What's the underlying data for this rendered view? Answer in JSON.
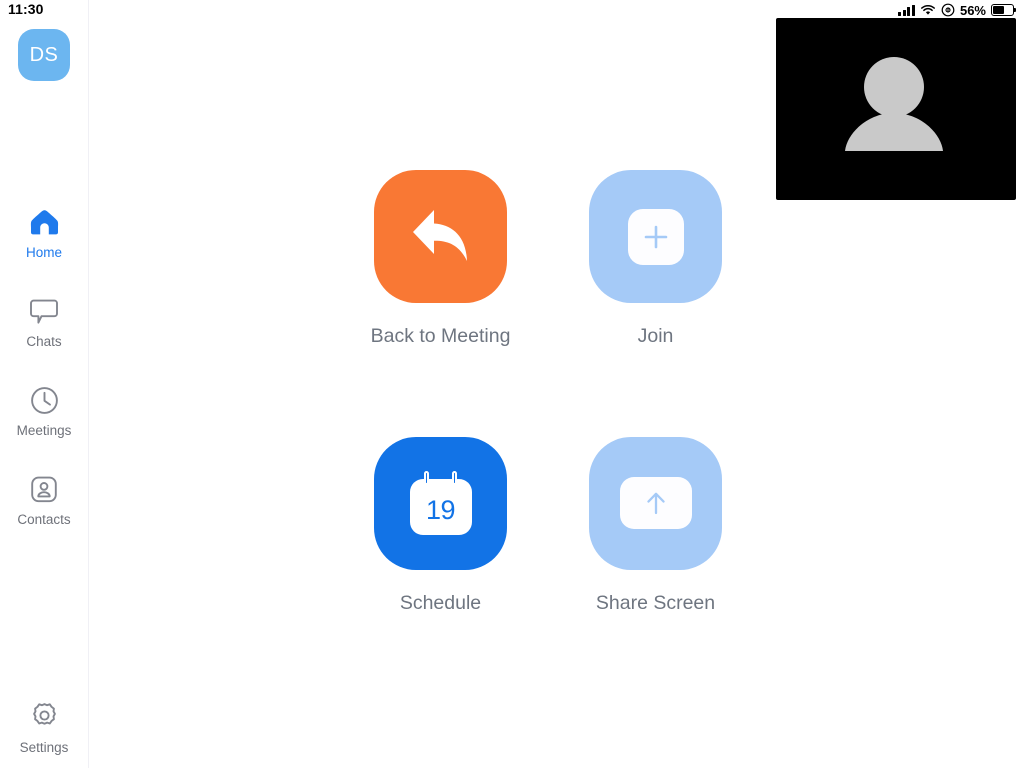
{
  "status_bar": {
    "time": "11:30",
    "battery_percent": "56%",
    "battery_level": 56,
    "icons": [
      "cellular-signal-icon",
      "wifi-icon",
      "orientation-lock-icon",
      "battery-icon"
    ]
  },
  "sidebar": {
    "avatar": {
      "initials": "DS",
      "color": "#6cb6f0",
      "name": "user-avatar"
    },
    "items": [
      {
        "label": "Home",
        "icon": "home-icon",
        "active": true
      },
      {
        "label": "Chats",
        "icon": "chat-bubble-icon",
        "active": false
      },
      {
        "label": "Meetings",
        "icon": "clock-icon",
        "active": false
      },
      {
        "label": "Contacts",
        "icon": "contacts-icon",
        "active": false
      }
    ],
    "settings": {
      "label": "Settings",
      "icon": "gear-icon"
    }
  },
  "video_thumbnail": {
    "name": "self-video-preview",
    "background": "#000000",
    "placeholder_icon": "person-silhouette-icon"
  },
  "main": {
    "actions": [
      {
        "label": "Back to Meeting",
        "icon": "reply-arrow-icon",
        "color": "#f97834",
        "style": "orange"
      },
      {
        "label": "Join",
        "icon": "plus-icon",
        "color": "#a5caf7",
        "style": "lightblue"
      },
      {
        "label": "Schedule",
        "icon": "calendar-icon",
        "color": "#1273e6",
        "style": "blue",
        "day": "19"
      },
      {
        "label": "Share Screen",
        "icon": "up-arrow-icon",
        "color": "#a5caf7",
        "style": "lightblue"
      }
    ]
  },
  "colors": {
    "accent_blue": "#1273e6",
    "active_nav": "#1f7aec",
    "orange": "#f97834",
    "light_blue": "#a5caf7",
    "label_gray": "#6e7580"
  }
}
